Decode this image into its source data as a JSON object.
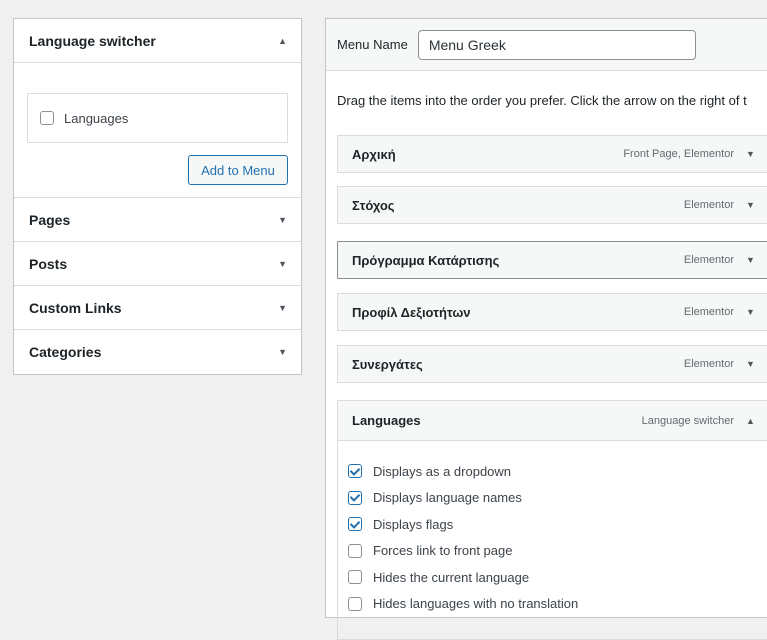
{
  "left": {
    "language_switcher": {
      "title": "Language switcher",
      "item_label": "Languages",
      "add_button": "Add to Menu"
    },
    "sections": [
      {
        "label": "Pages"
      },
      {
        "label": "Posts"
      },
      {
        "label": "Custom Links"
      },
      {
        "label": "Categories"
      }
    ]
  },
  "right": {
    "menu_name_label": "Menu Name",
    "menu_name_value": "Menu Greek",
    "instructions": "Drag the items into the order you prefer. Click the arrow on the right of t",
    "items": [
      {
        "title": "Αρχική",
        "type": "Front Page, Elementor"
      },
      {
        "title": "Στόχος",
        "type": "Elementor"
      },
      {
        "title": "Πρόγραμμα Κατάρτισης",
        "type": "Elementor"
      },
      {
        "title": "Προφίλ Δεξιοτήτων",
        "type": "Elementor"
      },
      {
        "title": "Συνεργάτες",
        "type": "Elementor"
      },
      {
        "title": "Languages",
        "type": "Language switcher"
      }
    ],
    "options": [
      {
        "label": "Displays as a dropdown",
        "checked": true
      },
      {
        "label": "Displays language names",
        "checked": true
      },
      {
        "label": "Displays flags",
        "checked": true
      },
      {
        "label": "Forces link to front page",
        "checked": false
      },
      {
        "label": "Hides the current language",
        "checked": false
      },
      {
        "label": "Hides languages with no translation",
        "checked": false
      }
    ]
  },
  "icons": {
    "collapse": "triangle-up-icon",
    "expand": "triangle-down-icon",
    "checkbox": "checkbox-icon"
  },
  "colors": {
    "accent": "#2271b1",
    "border": "#c3c4c7",
    "background": "#f0f0f1"
  }
}
